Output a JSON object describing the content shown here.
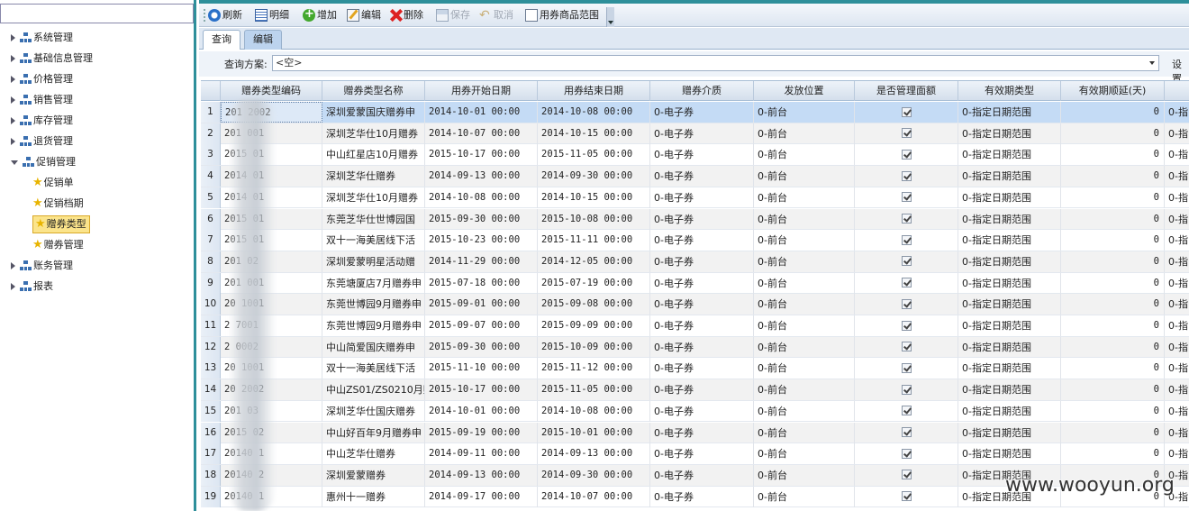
{
  "sidebar": {
    "search_value": "",
    "items": [
      {
        "label": "系统管理",
        "type": "group",
        "open": false
      },
      {
        "label": "基础信息管理",
        "type": "group",
        "open": false
      },
      {
        "label": "价格管理",
        "type": "group",
        "open": false
      },
      {
        "label": "销售管理",
        "type": "group",
        "open": false
      },
      {
        "label": "库存管理",
        "type": "group",
        "open": false
      },
      {
        "label": "退货管理",
        "type": "group",
        "open": false
      },
      {
        "label": "促销管理",
        "type": "group",
        "open": true
      },
      {
        "label": "促销单",
        "type": "leaf"
      },
      {
        "label": "促销档期",
        "type": "leaf"
      },
      {
        "label": "赠券类型",
        "type": "leaf",
        "selected": true
      },
      {
        "label": "赠券管理",
        "type": "leaf"
      },
      {
        "label": "账务管理",
        "type": "group",
        "open": false
      },
      {
        "label": "报表",
        "type": "group",
        "open": false
      }
    ]
  },
  "toolbar": {
    "refresh": "刷新",
    "detail": "明细",
    "add": "增加",
    "edit": "编辑",
    "delete": "删除",
    "save": "保存",
    "cancel": "取消",
    "goods_range": "用券商品范围"
  },
  "tabs": [
    {
      "label": "查询",
      "active": false
    },
    {
      "label": "编辑",
      "active": true
    }
  ],
  "query": {
    "label": "查询方案:",
    "value": "<空>",
    "settings": "设置"
  },
  "grid": {
    "columns": [
      "赠券类型编码",
      "赠券类型名称",
      "用券开始日期",
      "用券结束日期",
      "赠券介质",
      "发放位置",
      "是否管理面额",
      "有效期类型",
      "有效期顺延(天)"
    ],
    "rows": [
      {
        "n": "1",
        "code": "201  2002",
        "name": "深圳爱蒙国庆赠券申",
        "start": "2014-10-01 00:00",
        "end": "2014-10-08 00:00",
        "medium": "0-电子券",
        "pos": "0-前台",
        "valid": "0-指定日期范围",
        "delay": "0",
        "last": "0-指"
      },
      {
        "n": "2",
        "code": "201   001",
        "name": "深圳芝华仕10月赠券",
        "start": "2014-10-07 00:00",
        "end": "2014-10-15 00:00",
        "medium": "0-电子券",
        "pos": "0-前台",
        "valid": "0-指定日期范围",
        "delay": "0",
        "last": "0-指"
      },
      {
        "n": "3",
        "code": "2015    01",
        "name": "中山红星店10月赠券",
        "start": "2015-10-17 00:00",
        "end": "2015-11-05 00:00",
        "medium": "0-电子券",
        "pos": "0-前台",
        "valid": "0-指定日期范围",
        "delay": "0",
        "last": "0-指"
      },
      {
        "n": "4",
        "code": "2014    01",
        "name": "深圳芝华仕赠券",
        "start": "2014-09-13 00:00",
        "end": "2014-09-30 00:00",
        "medium": "0-电子券",
        "pos": "0-前台",
        "valid": "0-指定日期范围",
        "delay": "0",
        "last": "0-指"
      },
      {
        "n": "5",
        "code": "2014    01",
        "name": "深圳芝华仕10月赠券",
        "start": "2014-10-08 00:00",
        "end": "2014-10-15 00:00",
        "medium": "0-电子券",
        "pos": "0-前台",
        "valid": "0-指定日期范围",
        "delay": "0",
        "last": "0-指"
      },
      {
        "n": "6",
        "code": "2015    01",
        "name": "东莞芝华仕世博园国",
        "start": "2015-09-30 00:00",
        "end": "2015-10-08 00:00",
        "medium": "0-电子券",
        "pos": "0-前台",
        "valid": "0-指定日期范围",
        "delay": "0",
        "last": "0-指"
      },
      {
        "n": "7",
        "code": "2015    01",
        "name": "双十一海美居线下活",
        "start": "2015-10-23 00:00",
        "end": "2015-11-11 00:00",
        "medium": "0-电子券",
        "pos": "0-前台",
        "valid": "0-指定日期范围",
        "delay": "0",
        "last": "0-指"
      },
      {
        "n": "8",
        "code": "201    02",
        "name": "深圳爱蒙明星活动赠",
        "start": "2014-11-29 00:00",
        "end": "2014-12-05 00:00",
        "medium": "0-电子券",
        "pos": "0-前台",
        "valid": "0-指定日期范围",
        "delay": "0",
        "last": "0-指"
      },
      {
        "n": "9",
        "code": "201    001",
        "name": "东莞塘厦店7月赠券申",
        "start": "2015-07-18 00:00",
        "end": "2015-07-19 00:00",
        "medium": "0-电子券",
        "pos": "0-前台",
        "valid": "0-指定日期范围",
        "delay": "0",
        "last": "0-指"
      },
      {
        "n": "10",
        "code": "20   1001",
        "name": "东莞世博园9月赠券申",
        "start": "2015-09-01 00:00",
        "end": "2015-09-08 00:00",
        "medium": "0-电子券",
        "pos": "0-前台",
        "valid": "0-指定日期范围",
        "delay": "0",
        "last": "0-指"
      },
      {
        "n": "11",
        "code": "2   7001",
        "name": "东莞世博园9月赠券申",
        "start": "2015-09-07 00:00",
        "end": "2015-09-09 00:00",
        "medium": "0-电子券",
        "pos": "0-前台",
        "valid": "0-指定日期范围",
        "delay": "0",
        "last": "0-指"
      },
      {
        "n": "12",
        "code": "2   0002",
        "name": "中山简爱国庆赠券申",
        "start": "2015-09-30 00:00",
        "end": "2015-10-09 00:00",
        "medium": "0-电子券",
        "pos": "0-前台",
        "valid": "0-指定日期范围",
        "delay": "0",
        "last": "0-指"
      },
      {
        "n": "13",
        "code": "20   1001",
        "name": "双十一海美居线下活",
        "start": "2015-11-10 00:00",
        "end": "2015-11-12 00:00",
        "medium": "0-电子券",
        "pos": "0-前台",
        "valid": "0-指定日期范围",
        "delay": "0",
        "last": "0-指"
      },
      {
        "n": "14",
        "code": "20   2002",
        "name": "中山ZS01/ZS0210月赠",
        "start": "2015-10-17 00:00",
        "end": "2015-11-05 00:00",
        "medium": "0-电子券",
        "pos": "0-前台",
        "valid": "0-指定日期范围",
        "delay": "0",
        "last": "0-指"
      },
      {
        "n": "15",
        "code": "201    03",
        "name": "深圳芝华仕国庆赠券",
        "start": "2014-10-01 00:00",
        "end": "2014-10-08 00:00",
        "medium": "0-电子券",
        "pos": "0-前台",
        "valid": "0-指定日期范围",
        "delay": "0",
        "last": "0-指"
      },
      {
        "n": "16",
        "code": "2015    02",
        "name": "中山好百年9月赠券申",
        "start": "2015-09-19 00:00",
        "end": "2015-10-01 00:00",
        "medium": "0-电子券",
        "pos": "0-前台",
        "valid": "0-指定日期范围",
        "delay": "0",
        "last": "0-指"
      },
      {
        "n": "17",
        "code": "20140    1",
        "name": "中山芝华仕赠券",
        "start": "2014-09-11 00:00",
        "end": "2014-09-13 00:00",
        "medium": "0-电子券",
        "pos": "0-前台",
        "valid": "0-指定日期范围",
        "delay": "0",
        "last": "0-指"
      },
      {
        "n": "18",
        "code": "20140    2",
        "name": "深圳爱蒙赠券",
        "start": "2014-09-13 00:00",
        "end": "2014-09-30 00:00",
        "medium": "0-电子券",
        "pos": "0-前台",
        "valid": "0-指定日期范围",
        "delay": "0",
        "last": "0-指"
      },
      {
        "n": "19",
        "code": "20140    1",
        "name": "惠州十一赠券",
        "start": "2014-09-17 00:00",
        "end": "2014-10-07 00:00",
        "medium": "0-电子券",
        "pos": "0-前台",
        "valid": "0-指定日期范围",
        "delay": "0",
        "last": "0-指"
      }
    ]
  },
  "watermark": "www.wooyun.org"
}
